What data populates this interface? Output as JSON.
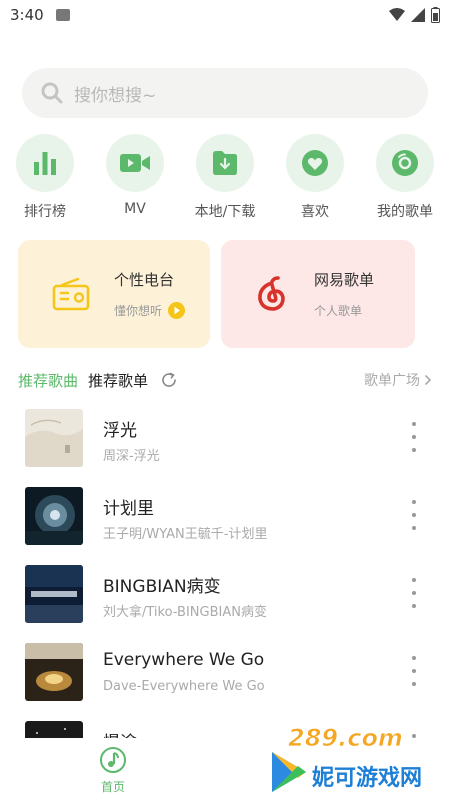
{
  "status_bar": {
    "time": "3:40"
  },
  "search": {
    "placeholder": "搜你想搜~"
  },
  "quick_actions": [
    {
      "label": "排行榜",
      "icon": "bar-chart-icon"
    },
    {
      "label": "MV",
      "icon": "video-icon"
    },
    {
      "label": "本地/下载",
      "icon": "download-icon"
    },
    {
      "label": "喜欢",
      "icon": "heart-icon"
    },
    {
      "label": "我的歌单",
      "icon": "disc-icon"
    }
  ],
  "cards": {
    "radio": {
      "title": "个性电台",
      "subtitle": "懂你想听",
      "icon": "radio-icon",
      "bg": "#fdf2d8"
    },
    "playlist": {
      "title": "网易歌单",
      "subtitle": "个人歌单",
      "icon": "netease-icon",
      "bg": "#fde7e7"
    }
  },
  "tabs": {
    "active": "推荐歌曲",
    "second": "推荐歌单",
    "more": "歌单广场"
  },
  "songs": [
    {
      "title": "浮光",
      "subtitle": "周深-浮光"
    },
    {
      "title": "计划里",
      "subtitle": "王子明/WYAN王毓千-计划里"
    },
    {
      "title": "BINGBIAN病变",
      "subtitle": "刘大拿/Tiko-BINGBIAN病变"
    },
    {
      "title": "Everywhere We Go",
      "subtitle": "Dave-Everywhere We Go"
    },
    {
      "title": "慢途",
      "subtitle": ""
    }
  ],
  "bottom_nav": {
    "home": "首页"
  },
  "watermark": {
    "text": "妮可游戏网",
    "logo_text": "289.com"
  },
  "colors": {
    "accent": "#5cb86a",
    "icon_bg": "#e8f4ea",
    "radio_yellow": "#f5c518",
    "netease_red": "#d7332b"
  }
}
